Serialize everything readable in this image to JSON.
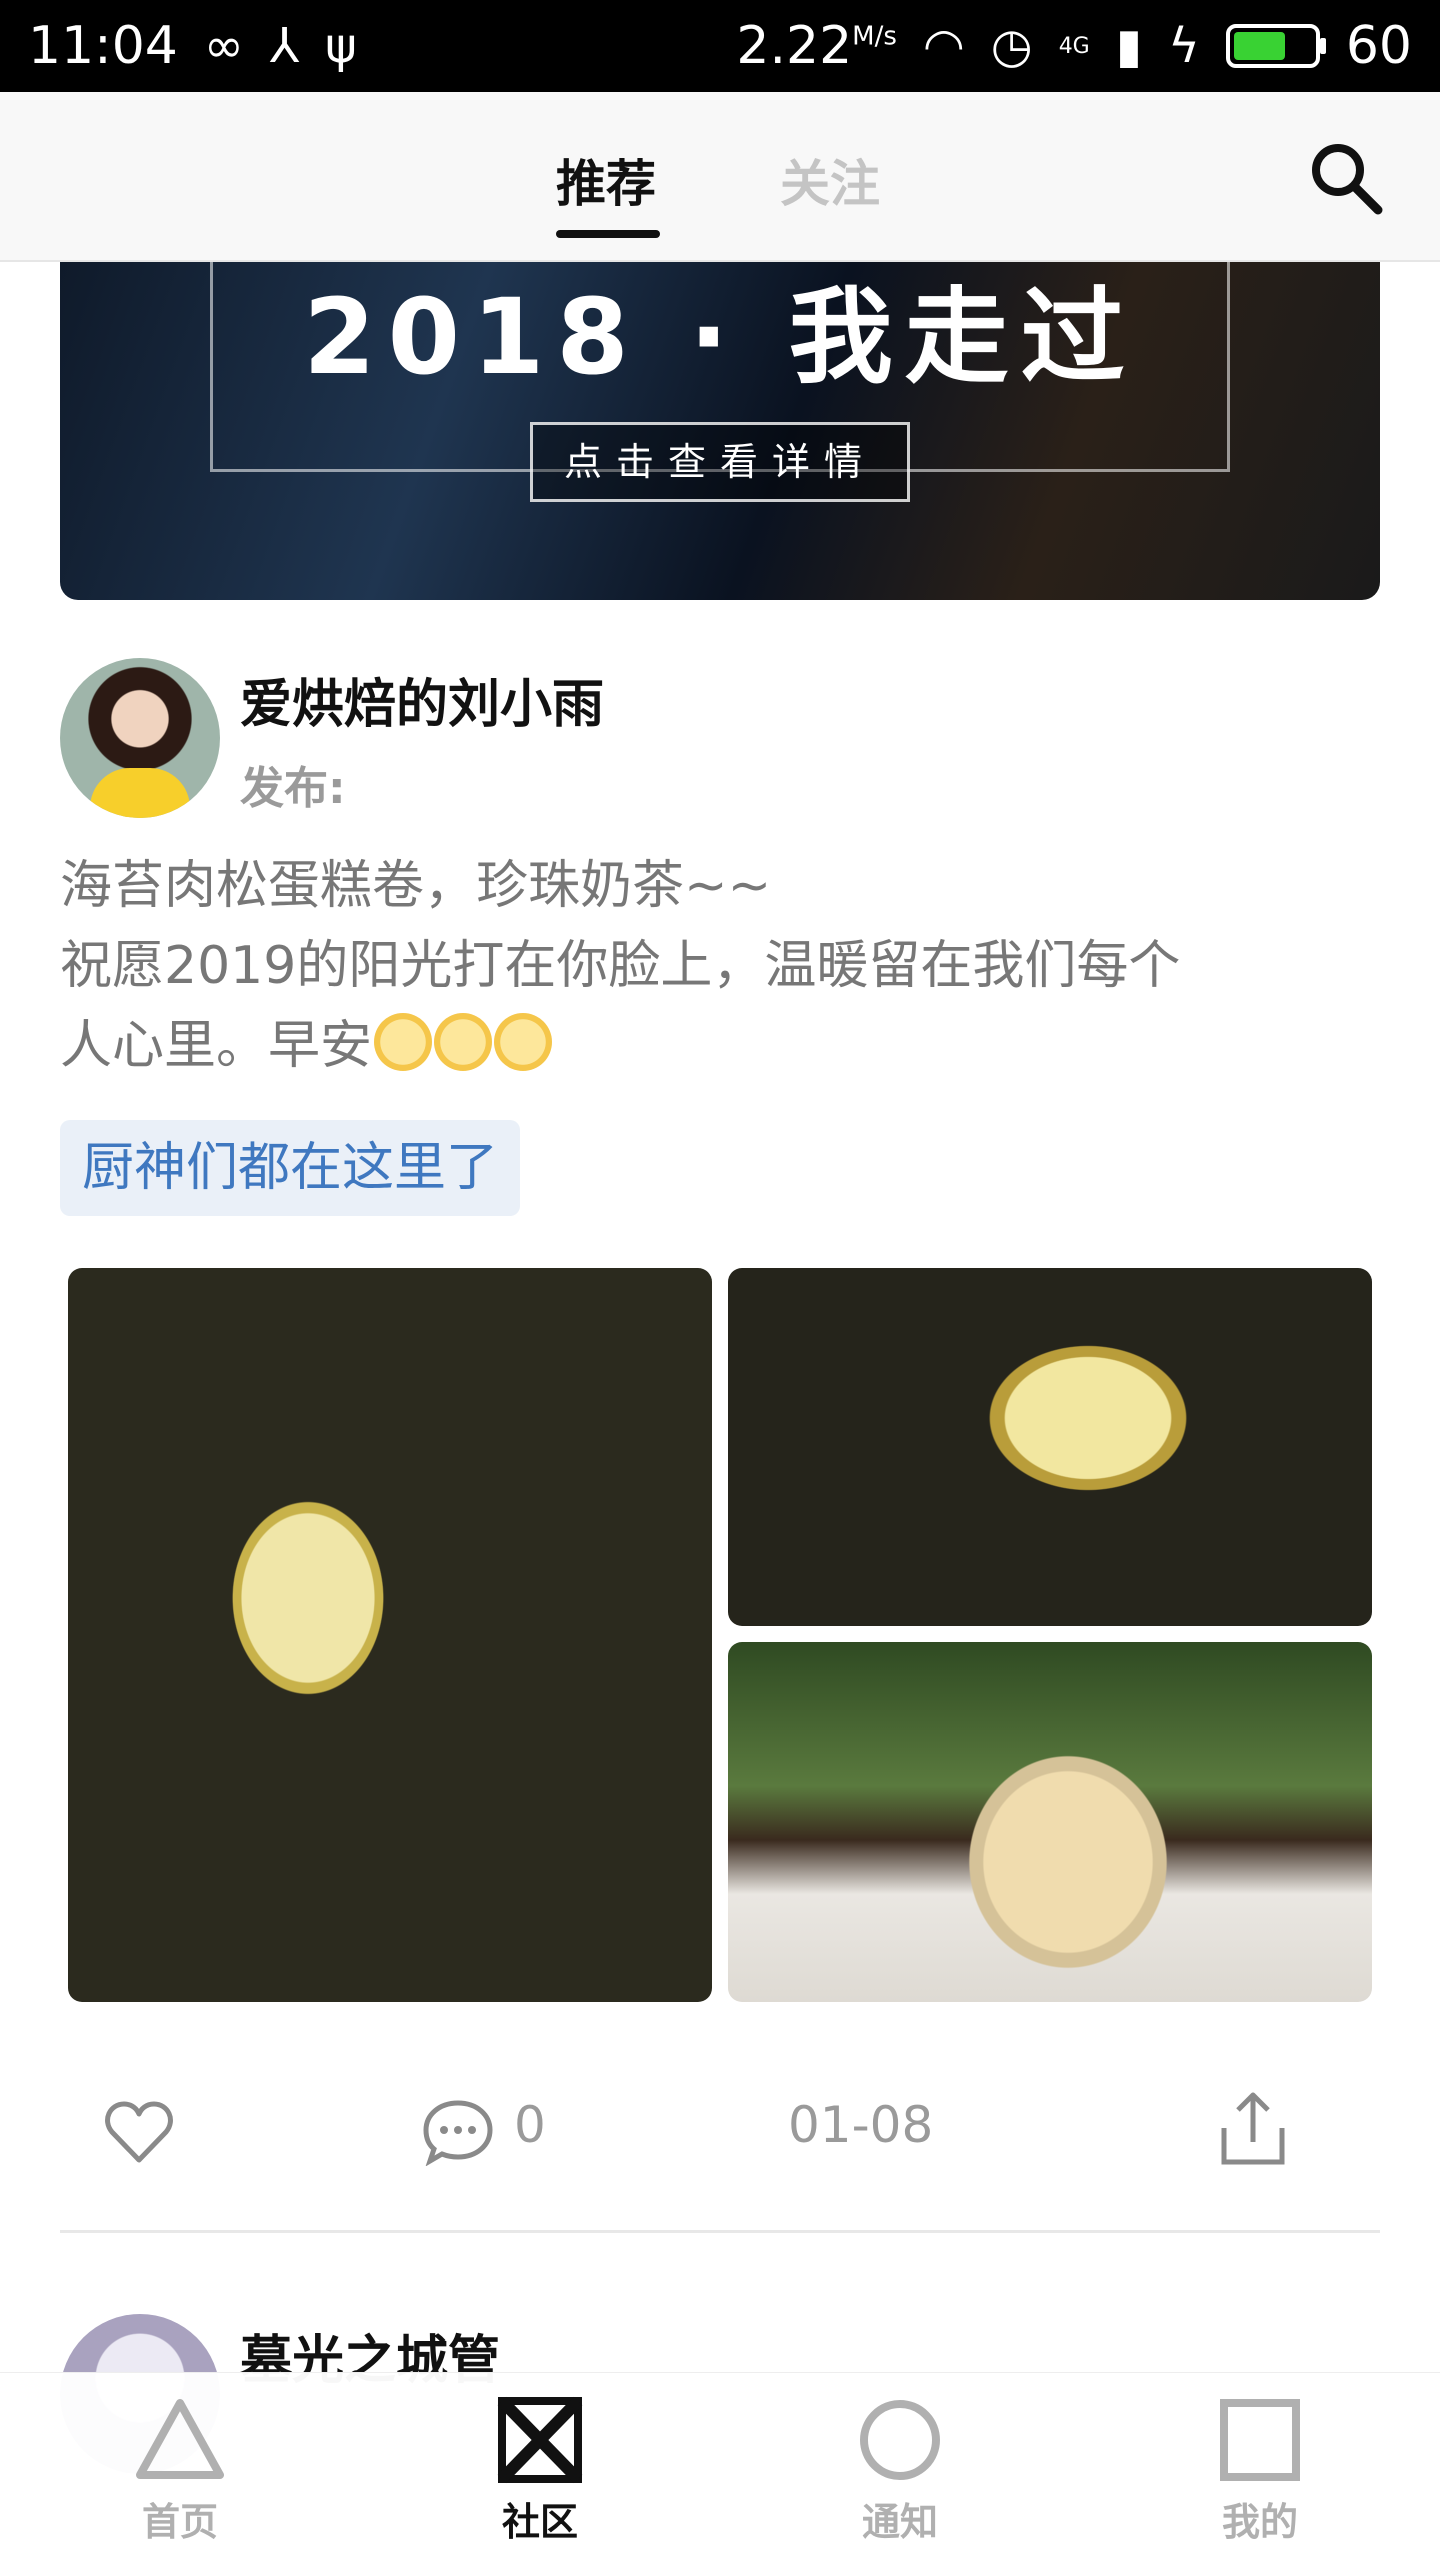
{
  "status_bar": {
    "time": "11:04",
    "network_speed": "2.22",
    "speed_unit": "M/s",
    "signal_type": "4G",
    "battery_level": "60"
  },
  "top_nav": {
    "tabs": [
      {
        "label": "推荐",
        "active": true
      },
      {
        "label": "关注",
        "active": false
      }
    ],
    "search_icon": "search-icon"
  },
  "banner": {
    "title": "2018 · 我走过",
    "button_label": "点击查看详情"
  },
  "post": {
    "username": "爱烘焙的刘小雨",
    "publish_label": "发布:",
    "text_lines": [
      "海苔肉松蛋糕卷，珍珠奶茶~~",
      "祝愿2019的阳光打在你脸上，温暖留在我们每个",
      "人心里。早安"
    ],
    "tag": "厨神们都在这里了",
    "comment_count": "0",
    "date": "01-08"
  },
  "next_post": {
    "username": "墓光之城管"
  },
  "bottom_nav": {
    "items": [
      {
        "label": "首页",
        "icon": "triangle-icon",
        "active": false
      },
      {
        "label": "社区",
        "icon": "cross-icon",
        "active": true
      },
      {
        "label": "通知",
        "icon": "circle-icon",
        "active": false
      },
      {
        "label": "我的",
        "icon": "square-icon",
        "active": false
      }
    ]
  },
  "colors": {
    "accent_tag": "#3f78c0",
    "tag_bg": "#eaf0f8",
    "battery": "#39d233"
  }
}
